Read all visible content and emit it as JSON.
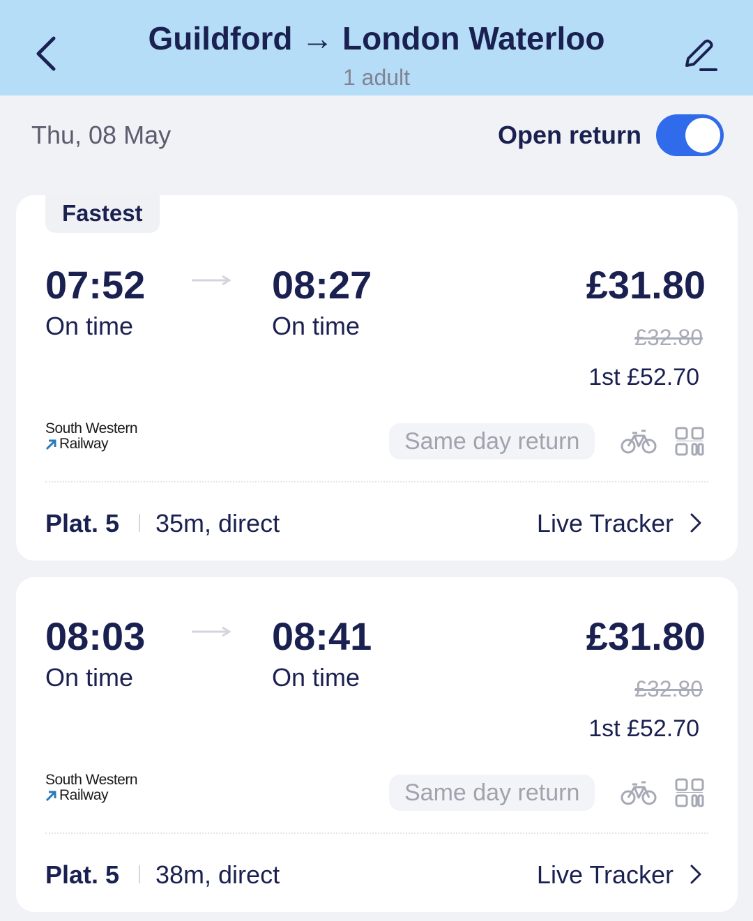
{
  "header": {
    "from": "Guildford",
    "arrow": "→",
    "to": "London Waterloo",
    "passengers": "1 adult"
  },
  "date": "Thu, 08 May",
  "open_return": {
    "label": "Open return",
    "enabled": true
  },
  "colors": {
    "header_bg": "#b5ddf7",
    "toggle_on": "#2f6bea",
    "text": "#1a2151"
  },
  "icons": [
    "back-chevron-icon",
    "edit-pencil-icon",
    "arrow-right-icon",
    "bicycle-icon",
    "qr-code-icon",
    "chevron-right-icon"
  ],
  "journeys": [
    {
      "badge": "Fastest",
      "depart": "07:52",
      "depart_status": "On time",
      "arrive": "08:27",
      "arrive_status": "On time",
      "price": "£31.80",
      "old_price": "£32.80",
      "first_class": "1st £52.70",
      "operator_line1": "South Western",
      "operator_line2": "Railway",
      "ticket_type": "Same day return",
      "platform": "Plat. 5",
      "duration": "35m, direct",
      "tracker": "Live Tracker"
    },
    {
      "badge": "",
      "depart": "08:03",
      "depart_status": "On time",
      "arrive": "08:41",
      "arrive_status": "On time",
      "price": "£31.80",
      "old_price": "£32.80",
      "first_class": "1st £52.70",
      "operator_line1": "South Western",
      "operator_line2": "Railway",
      "ticket_type": "Same day return",
      "platform": "Plat. 5",
      "duration": "38m, direct",
      "tracker": "Live Tracker"
    }
  ]
}
